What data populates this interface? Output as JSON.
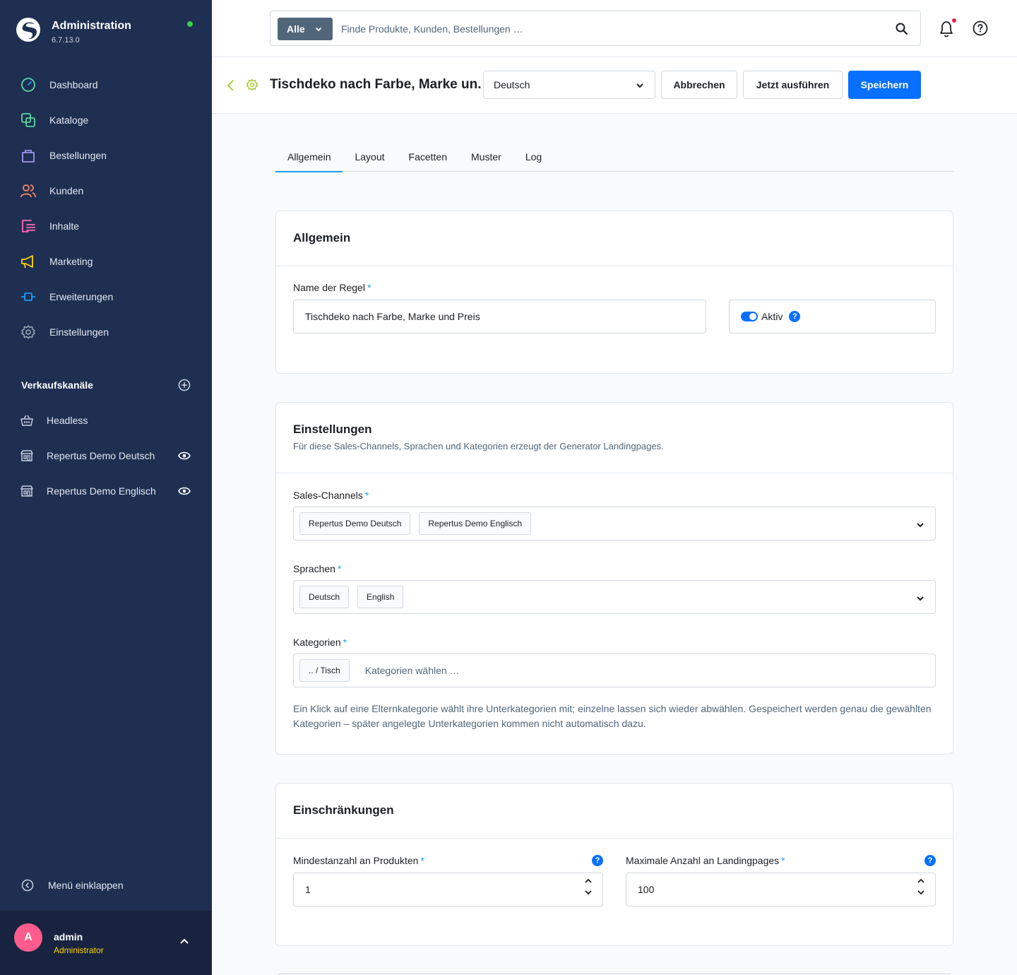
{
  "sidebar": {
    "brand_title": "Administration",
    "brand_version": "6.7.13.0",
    "nav": [
      {
        "label": "Dashboard",
        "icon": "dashboard-icon",
        "color": "#57d9a3"
      },
      {
        "label": "Kataloge",
        "icon": "catalog-icon",
        "color": "#57d9a3"
      },
      {
        "label": "Bestellungen",
        "icon": "orders-icon",
        "color": "#a092f0"
      },
      {
        "label": "Kunden",
        "icon": "customers-icon",
        "color": "#f88962"
      },
      {
        "label": "Inhalte",
        "icon": "content-icon",
        "color": "#ff68b4"
      },
      {
        "label": "Marketing",
        "icon": "marketing-icon",
        "color": "#ffd500"
      },
      {
        "label": "Erweiterungen",
        "icon": "extensions-icon",
        "color": "#189eff"
      },
      {
        "label": "Einstellungen",
        "icon": "settings-icon",
        "color": "#9aa8b5"
      }
    ],
    "channels_title": "Verkaufskanäle",
    "channels": [
      {
        "label": "Headless",
        "icon": "basket-icon"
      },
      {
        "label": "Repertus Demo Deutsch",
        "icon": "storefront-icon"
      },
      {
        "label": "Repertus Demo Englisch",
        "icon": "storefront-icon"
      }
    ],
    "collapse_label": "Menü einklappen",
    "user": {
      "initial": "A",
      "name": "admin",
      "role": "Administrator"
    }
  },
  "topbar": {
    "filter_label": "Alle",
    "search_placeholder": "Finde Produkte, Kunden, Bestellungen …"
  },
  "smartbar": {
    "title": "Tischdeko nach Farbe, Marke un...",
    "language": "Deutsch",
    "cancel_label": "Abbrechen",
    "run_label": "Jetzt ausführen",
    "save_label": "Speichern"
  },
  "tabs": [
    "Allgemein",
    "Layout",
    "Facetten",
    "Muster",
    "Log"
  ],
  "general": {
    "title": "Allgemein",
    "name_label": "Name der Regel",
    "name_value": "Tischdeko nach Farbe, Marke und Preis",
    "active_label": "Aktiv"
  },
  "settings": {
    "title": "Einstellungen",
    "subtitle": "Für diese Sales-Channels, Sprachen und Kategorien erzeugt der Generator Landingpages.",
    "sales_channels_label": "Sales-Channels",
    "sales_channels": [
      "Repertus Demo Deutsch",
      "Repertus Demo Englisch"
    ],
    "languages_label": "Sprachen",
    "languages": [
      "Deutsch",
      "English"
    ],
    "categories_label": "Kategorien",
    "categories": [
      ".. / Tisch"
    ],
    "categories_placeholder": "Kategorien wählen …",
    "hint": "Ein Klick auf eine Elternkategorie wählt ihre Unterkategorien mit; einzelne lassen sich wieder abwählen. Gespeichert werden genau die gewählten Kategorien – später angelegte Unterkategorien kommen nicht automatisch dazu."
  },
  "limits": {
    "title": "Einschränkungen",
    "min_label": "Mindestanzahl an Produkten",
    "min_value": "1",
    "max_label": "Maximale Anzahl an Landingpages",
    "max_value": "100"
  },
  "colors": {
    "accent": "#0870ff",
    "sidebar_bg": "#1f2f52",
    "status": "#37d046"
  }
}
